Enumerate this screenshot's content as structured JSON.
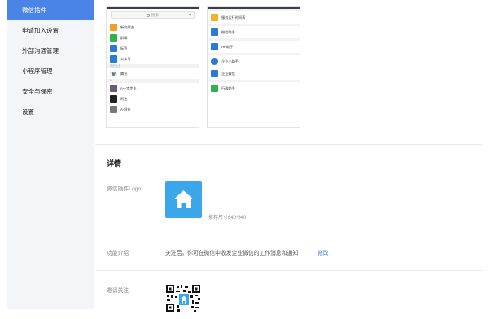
{
  "sidebar": {
    "items": [
      {
        "label": "微信插件",
        "active": true
      },
      {
        "label": "申请加入设置"
      },
      {
        "label": "外部沟通管理"
      },
      {
        "label": "小程序管理"
      },
      {
        "label": "安全与保密"
      },
      {
        "label": "设置"
      }
    ]
  },
  "phone_left": {
    "search_placeholder": "搜索",
    "plus": "+",
    "rows_top": [
      {
        "label": "新的朋友",
        "icon": "new-friend-icon",
        "color": "#f39c28"
      },
      {
        "label": "群聊",
        "icon": "group-chat-icon",
        "color": "#2fb24c"
      },
      {
        "label": "标签",
        "icon": "tag-icon",
        "color": "#2a7ad9"
      },
      {
        "label": "公众号",
        "icon": "official-account-icon",
        "color": "#2a7ad9"
      }
    ],
    "section_work": "我的企业",
    "rows_mid": [
      {
        "label": "腾讯",
        "icon": "tencent-logo-icon",
        "color": "#ffffff"
      }
    ],
    "section_letter": "A",
    "rows_bottom": [
      {
        "label": "A一步步走",
        "icon": "contact-avatar-icon",
        "color": "#6a5a7a"
      },
      {
        "label": "阿土",
        "icon": "contact-avatar-icon",
        "color": "#222222"
      },
      {
        "label": "A-阿布",
        "icon": "contact-avatar-icon",
        "color": "#777777"
      }
    ]
  },
  "phone_right": {
    "rows": [
      {
        "label": "服务运行时间表",
        "icon": "schedule-icon",
        "color": "#f3b021"
      },
      {
        "label": "微信助手",
        "icon": "wechat-helper-icon",
        "color": "#2a7ad9"
      },
      {
        "label": "HR助手",
        "icon": "hr-helper-icon",
        "color": "#2a7ad9"
      },
      {
        "label": "企业小助手",
        "icon": "enterprise-helper-icon",
        "color": "#2a7ad9"
      },
      {
        "label": "企业微信",
        "icon": "wework-icon",
        "color": "#2a7ad9"
      },
      {
        "label": "行政助手",
        "icon": "admin-helper-icon",
        "color": "#2fb24c"
      }
    ]
  },
  "details": {
    "title": "详情",
    "logo_label": "微信插件Logo",
    "logo_size_hint": "推荐尺寸640*640",
    "intro_label": "功能介绍",
    "intro_text": "关注后，你可在微信中收发企业微信的工作消息和通知",
    "modify_label": "修改",
    "invite_label": "邀请关注"
  },
  "colors": {
    "accent": "#4a84e6",
    "logo_bg": "#3ba7ea",
    "link": "#3a80d6"
  }
}
